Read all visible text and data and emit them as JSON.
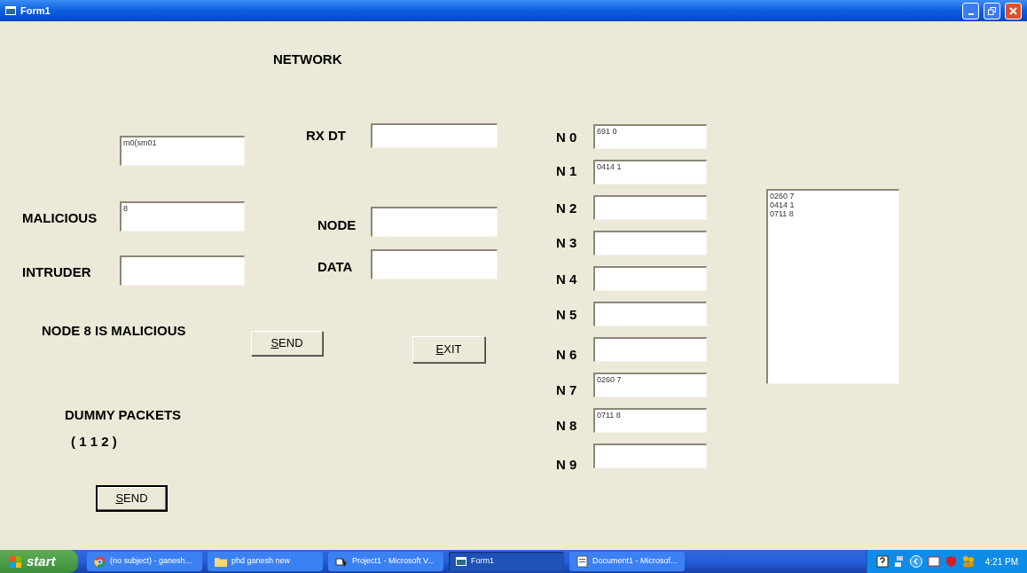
{
  "window": {
    "title": "Form1"
  },
  "form": {
    "labels": [
      {
        "text": "NETWORK"
      },
      {
        "text": "MALICIOUS"
      },
      {
        "text": "INTRUDER"
      },
      {
        "text": "NODE 8 IS MALICIOUS"
      },
      {
        "text": "DUMMY PACKETS"
      },
      {
        "text": "( 1 1 2 )"
      },
      {
        "text": "RX DT"
      },
      {
        "text": "NODE"
      },
      {
        "text": "DATA"
      }
    ],
    "textboxes": [
      {
        "kind": "text",
        "value": "m0(sm01"
      },
      {
        "kind": "text",
        "value": "8"
      },
      {
        "kind": "text"
      },
      {
        "kind": "text"
      },
      {
        "kind": "text"
      },
      {
        "kind": "text"
      }
    ],
    "buttons": [
      {
        "label": "SEND",
        "default": true
      },
      {
        "label": "SEND",
        "default": false
      },
      {
        "label": "EXIT",
        "default": false
      }
    ],
    "nodes": [
      {
        "label": "N 0",
        "value": "691 0"
      },
      {
        "label": "N 1",
        "value": "0414 1"
      },
      {
        "label": "N 2"
      },
      {
        "label": "N 3"
      },
      {
        "label": "N 4"
      },
      {
        "label": "N 5"
      },
      {
        "label": "N 6"
      },
      {
        "label": "N 7",
        "value": "0260 7"
      },
      {
        "label": "N 8",
        "value": "0711 8"
      },
      {
        "label": "N 9"
      }
    ],
    "listbox": {
      "items": [
        "0260 7",
        "0414 1",
        "0711 8"
      ]
    }
  },
  "taskbar": {
    "start": "start",
    "tasks": [
      {
        "label": "(no subject) - ganesh...",
        "kind": "browser",
        "selected": false
      },
      {
        "label": "phd ganesh new",
        "kind": "folder",
        "selected": false
      },
      {
        "label": "Project1 - Microsoft V...",
        "kind": "ide",
        "selected": false
      },
      {
        "label": "Form1",
        "kind": "form",
        "selected": true
      },
      {
        "label": "Document1 - Microsof...",
        "kind": "document",
        "selected": false
      }
    ],
    "clock": "4:21 PM"
  }
}
